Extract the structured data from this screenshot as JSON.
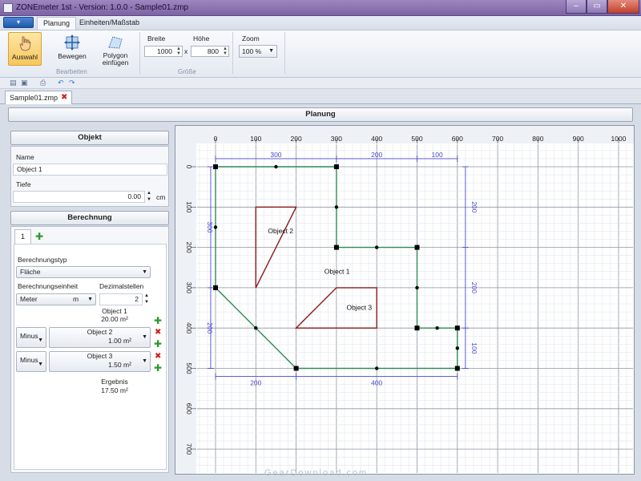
{
  "window": {
    "title": "ZONEmeter 1st - Version: 1.0.0 - Sample01.zmp",
    "minimize": "–",
    "maximize": "▭",
    "close": "✕"
  },
  "ribbon": {
    "tabs": [
      "Planung",
      "Einheiten/Maßstab"
    ],
    "bearbeiten": {
      "label": "Bearbeiten",
      "buttons": [
        "Auswahl",
        "Bewegen",
        "Polygon einfügen"
      ]
    },
    "groesse": {
      "label": "Größe",
      "breite_label": "Breite",
      "breite_value": "1000",
      "x_sep": "x",
      "hoehe_label": "Höhe",
      "hoehe_value": "800"
    },
    "zoom": {
      "label": "Zoom",
      "value": "100 %"
    }
  },
  "document": {
    "tab": "Sample01.zmp"
  },
  "planung_header": "Planung",
  "objekt": {
    "header": "Objekt",
    "name_label": "Name",
    "name_value": "Object 1",
    "tiefe_label": "Tiefe",
    "tiefe_value": "0.00",
    "tiefe_unit": "cm"
  },
  "berechnung": {
    "header": "Berechnung",
    "tab": "1",
    "typ_label": "Berechnungstyp",
    "typ_value": "Fläche",
    "einheit_label": "Berechnungseinheit",
    "einheit_value": "Meter",
    "einheit_unit": "m",
    "dezimal_label": "Dezimalstellen",
    "dezimal_value": "2",
    "rows": [
      {
        "op": "",
        "name": "Object 1",
        "value": "20.00",
        "unit": "m²"
      },
      {
        "op": "Minus",
        "name": "Object 2",
        "value": "1.00",
        "unit": "m²"
      },
      {
        "op": "Minus",
        "name": "Object 3",
        "value": "1.50",
        "unit": "m²"
      }
    ],
    "ergebnis_label": "Ergebnis",
    "ergebnis_value": "17.50",
    "ergebnis_unit": "m²"
  },
  "canvas": {
    "x_ticks": [
      "0",
      "100",
      "200",
      "300",
      "400",
      "500",
      "600",
      "700",
      "800",
      "900",
      "1000"
    ],
    "y_ticks": [
      "0",
      "100",
      "200",
      "300",
      "400",
      "500",
      "600",
      "700"
    ],
    "objects": [
      {
        "name": "Object 1",
        "points": [
          [
            0,
            0
          ],
          [
            300,
            0
          ],
          [
            300,
            200
          ],
          [
            500,
            200
          ],
          [
            500,
            400
          ],
          [
            600,
            400
          ],
          [
            600,
            500
          ],
          [
            200,
            500
          ],
          [
            0,
            300
          ]
        ]
      },
      {
        "name": "Object 2",
        "points": [
          [
            100,
            100
          ],
          [
            200,
            100
          ],
          [
            100,
            300
          ]
        ]
      },
      {
        "name": "Object 3",
        "points": [
          [
            300,
            300
          ],
          [
            400,
            300
          ],
          [
            400,
            400
          ],
          [
            200,
            400
          ]
        ]
      }
    ],
    "dimensions": {
      "top": [
        "300",
        "200",
        "100"
      ],
      "bottom": [
        "200",
        "400"
      ],
      "left": [
        "300",
        "200"
      ],
      "right": [
        "200",
        "200",
        "100"
      ]
    },
    "colors": {
      "object1": "#2e8b57",
      "object2": "#8b1a1a",
      "object3": "#8b1a1a",
      "dimension": "#4a4ad0"
    }
  },
  "watermark": "GearDownload.com"
}
